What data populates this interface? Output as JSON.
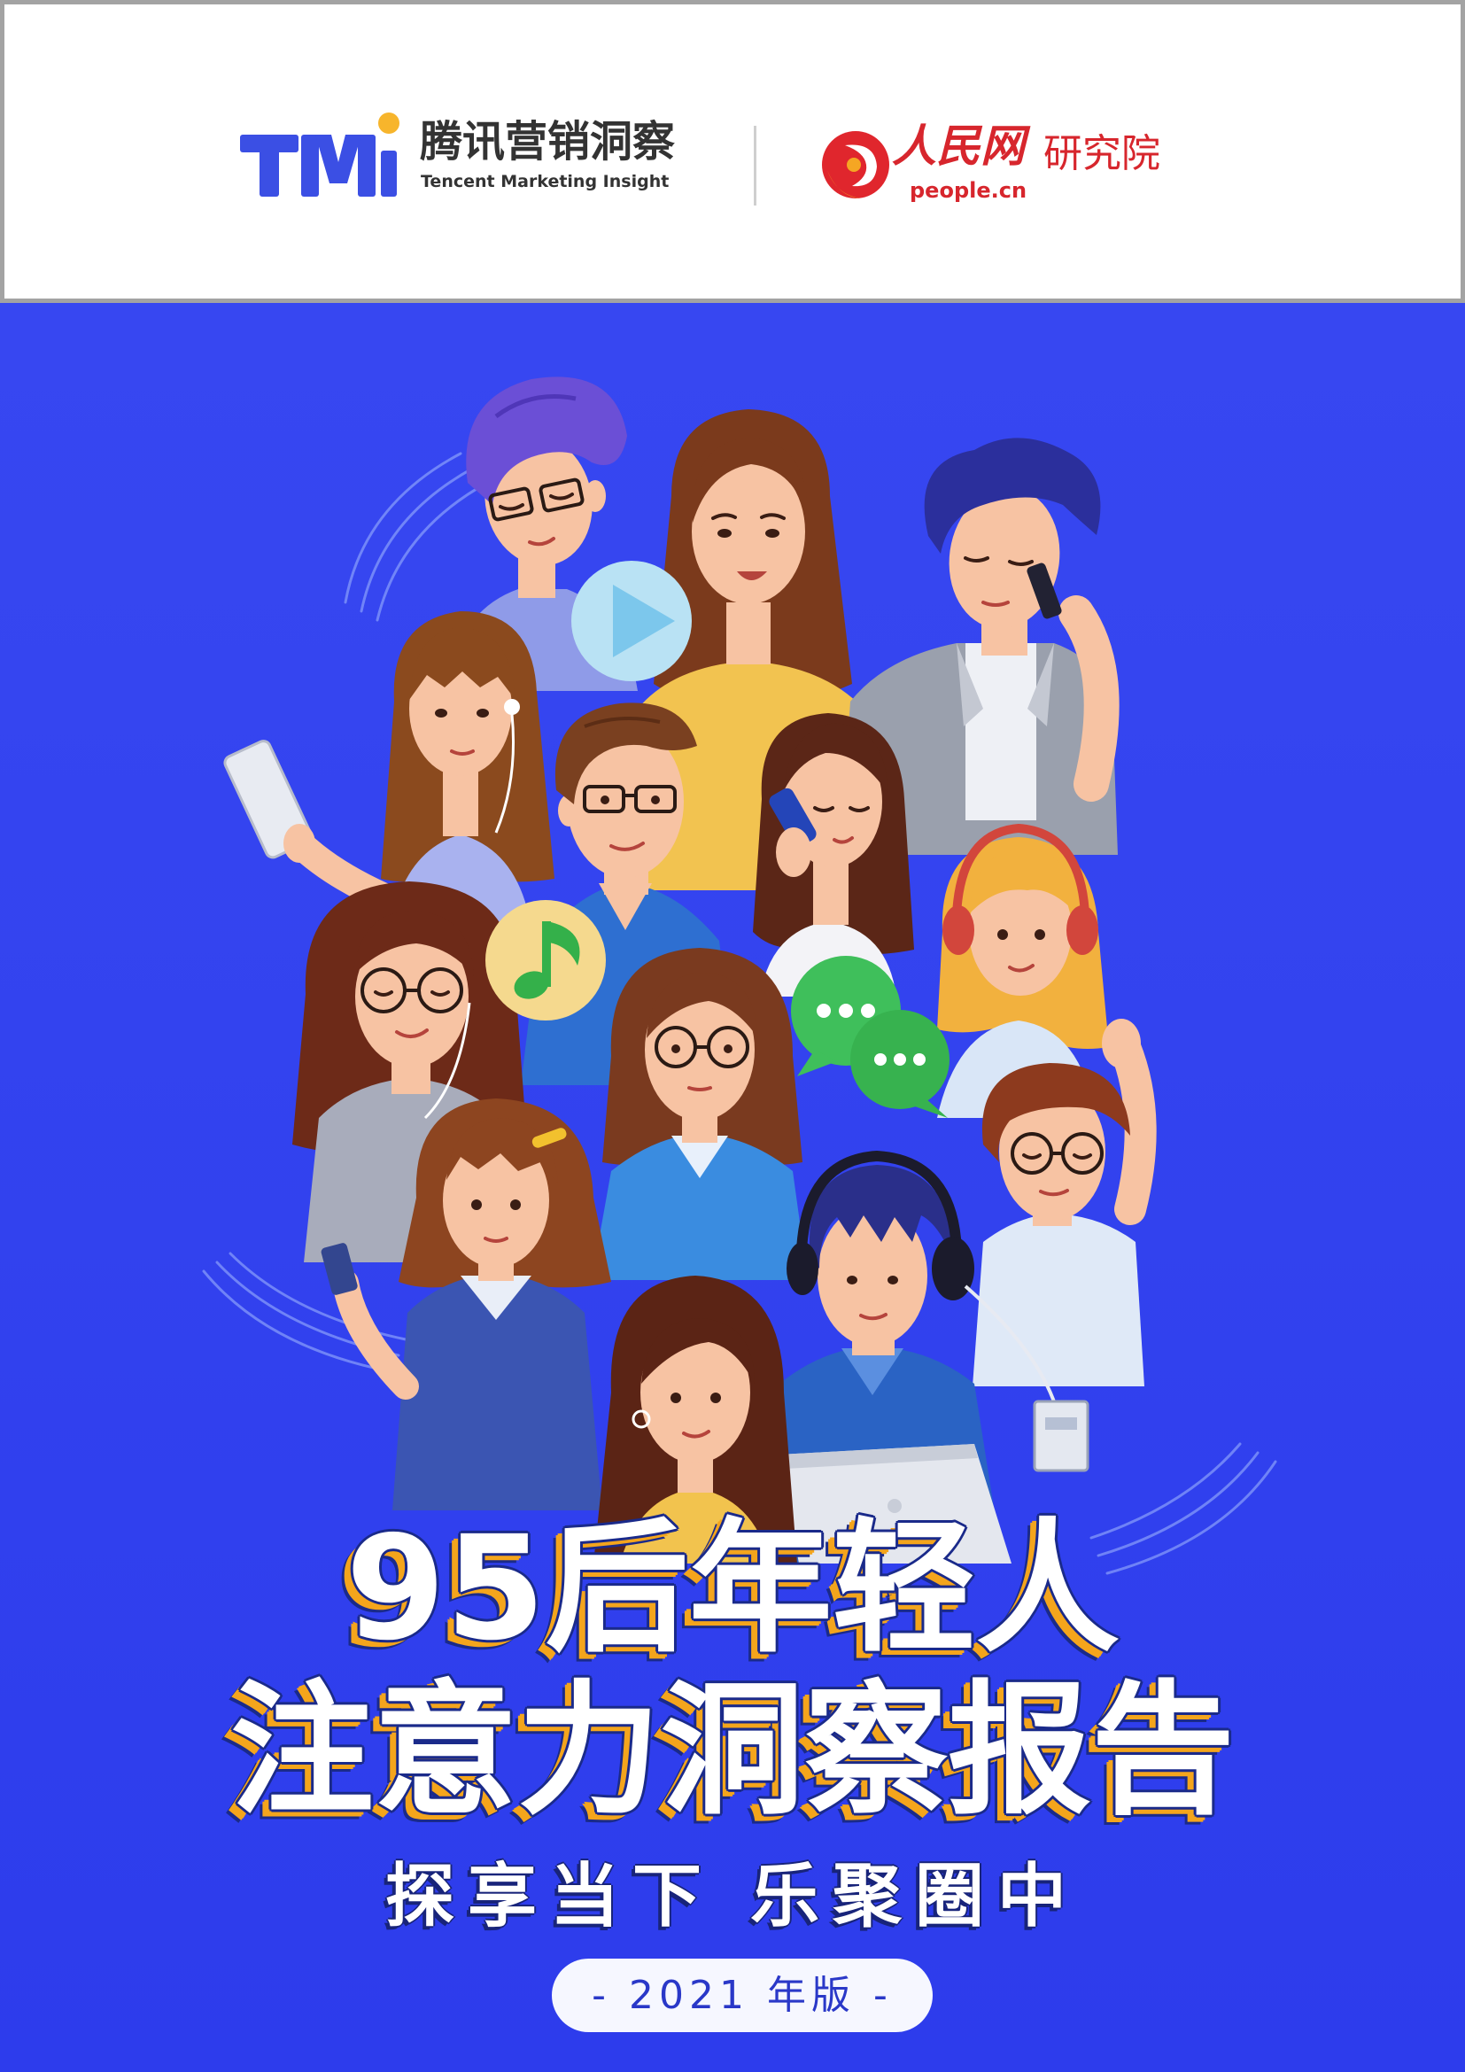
{
  "header": {
    "tmi_logo_mark": "TMi",
    "tmi_name_cn": "腾讯营销洞察",
    "tmi_name_en": "Tencent Marketing Insight",
    "people_logo_cn": "人民网",
    "people_logo_domain": "people.cn",
    "people_unit": "研究院"
  },
  "cover": {
    "title_line1": "95后年轻人",
    "title_line2": "注意力洞察报告",
    "subtitle_part1": "探享当下",
    "subtitle_part2": "乐聚圈中",
    "edition": "- 2021 年版 -"
  },
  "icons": [
    "play-icon",
    "music-note-icon",
    "chat-bubble-icon",
    "smartphone-icon",
    "headphones-icon",
    "laptop-icon"
  ],
  "colors": {
    "background_blue": "#3343ef",
    "title_outline": "#1a2a8a",
    "title_shadow": "#f4a51c",
    "tmi_blue": "#3b4fe4",
    "tmi_dot": "#f7b52c",
    "people_red": "#d7262d",
    "edition_text": "#2a38c8"
  }
}
